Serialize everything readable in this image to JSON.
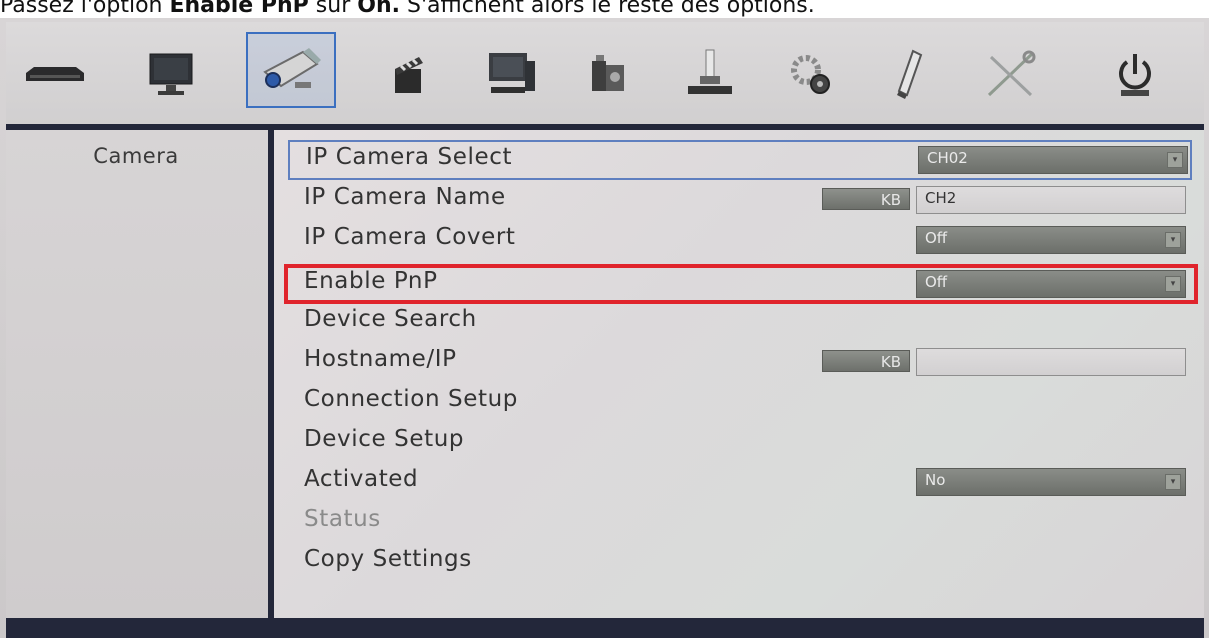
{
  "caption": {
    "prefix": "Passez l'option ",
    "bold": "Enable PnP",
    "middle": " sur ",
    "bold2": "On.",
    "suffix": " S'affichent alors le reste des options."
  },
  "toolbar": {
    "icons": [
      {
        "name": "recorder-icon"
      },
      {
        "name": "monitor-icon"
      },
      {
        "name": "camera-icon"
      },
      {
        "name": "clapperboard-icon"
      },
      {
        "name": "desktop-icon"
      },
      {
        "name": "devices-icon"
      },
      {
        "name": "storage-icon"
      },
      {
        "name": "settings-gear-icon"
      },
      {
        "name": "usb-icon"
      },
      {
        "name": "tools-icon"
      },
      {
        "name": "power-icon"
      }
    ]
  },
  "sidebar": {
    "items": [
      {
        "label": "Camera"
      }
    ]
  },
  "settings": {
    "ip_camera_select": {
      "label": "IP Camera Select",
      "value": "CH02"
    },
    "ip_camera_name": {
      "label": "IP Camera Name",
      "kb": "KB",
      "value": "CH2"
    },
    "ip_camera_covert": {
      "label": "IP Camera Covert",
      "value": "Off"
    },
    "enable_pnp": {
      "label": "Enable PnP",
      "value": "Off"
    },
    "device_search": {
      "label": "Device Search"
    },
    "hostname_ip": {
      "label": "Hostname/IP",
      "kb": "KB",
      "value": ""
    },
    "connection_setup": {
      "label": "Connection Setup"
    },
    "device_setup": {
      "label": "Device Setup"
    },
    "activated": {
      "label": "Activated",
      "value": "No"
    },
    "status": {
      "label": "Status"
    },
    "copy_settings": {
      "label": "Copy Settings"
    }
  },
  "colors": {
    "highlight": "#e0242c",
    "selection": "#3b6fc0",
    "frame": "#23273a"
  }
}
